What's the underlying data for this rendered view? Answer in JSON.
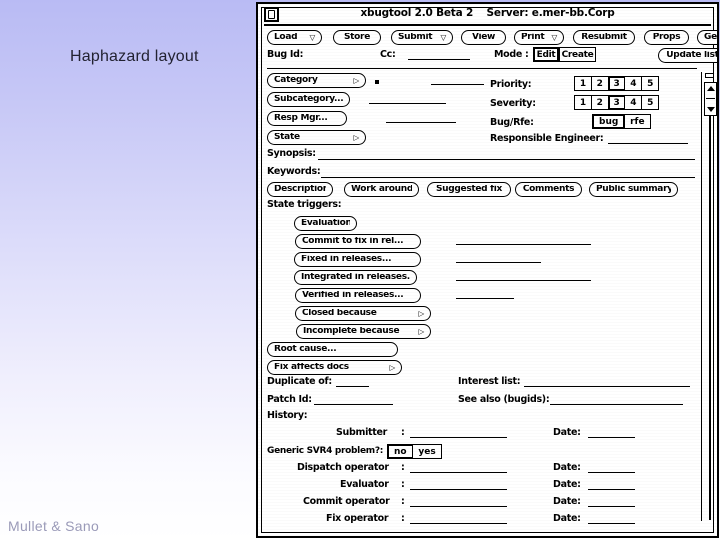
{
  "slide": {
    "title": "Haphazard layout",
    "credit": "Mullet & Sano",
    "background_top": "#b9bbf4",
    "background_bottom": "#ffffff"
  },
  "window": {
    "app_title": "xbugtool 2.0 Beta 2",
    "server_label": "Server: e.mer-bb.Corp",
    "menu_icon": "window-menu-icon",
    "toolbar": [
      {
        "label": "Load",
        "marker": "▽"
      },
      {
        "label": "Store",
        "marker": ""
      },
      {
        "label": "Submit",
        "marker": "▽"
      },
      {
        "label": "View",
        "marker": ""
      },
      {
        "label": "Print",
        "marker": "▽"
      },
      {
        "label": "Resubmit",
        "marker": ""
      },
      {
        "label": "Props",
        "marker": ""
      },
      {
        "label": "Gen. Help",
        "marker": "▽"
      }
    ],
    "update_lists_label": "Update lists",
    "bug_id_label": "Bug Id:",
    "cc_label": "Cc:",
    "mode_label": "Mode :",
    "mode_options": [
      {
        "label": "Edit",
        "selected": true
      },
      {
        "label": "Create",
        "selected": false
      }
    ],
    "left_menu_buttons": [
      {
        "label": "Category",
        "marker": "▷"
      },
      {
        "label": "Subcategory...",
        "marker": ""
      },
      {
        "label": "Resp Mgr...",
        "marker": ""
      },
      {
        "label": "State",
        "marker": "▷"
      }
    ],
    "priority_label": "Priority:",
    "priority_options": [
      "1",
      "2",
      "3",
      "4",
      "5"
    ],
    "priority_selected": "3",
    "severity_label": "Severity:",
    "severity_options": [
      "1",
      "2",
      "3",
      "4",
      "5"
    ],
    "severity_selected": "3",
    "bugrfe_label": "Bug/Rfe:",
    "bugrfe_options": [
      {
        "label": "bug",
        "selected": true
      },
      {
        "label": "rfe",
        "selected": false
      }
    ],
    "responsible_engineer_label": "Responsible Engineer:",
    "synopsis_label": "Synopsis:",
    "keywords_label": "Keywords:",
    "text_section_buttons": [
      "Description",
      "Work around",
      "Suggested fix",
      "Comments",
      "Public summary"
    ],
    "state_triggers_label": "State triggers:",
    "state_triggers": [
      {
        "label": "Evaluation",
        "marker": ""
      },
      {
        "label": "Commit to fix in rel...",
        "marker": ""
      },
      {
        "label": "Fixed in releases...",
        "marker": ""
      },
      {
        "label": "Integrated in releases...",
        "marker": ""
      },
      {
        "label": "Verified in releases...",
        "marker": ""
      },
      {
        "label": "Closed because",
        "marker": "▷"
      },
      {
        "label": "Incomplete because",
        "marker": "▷"
      }
    ],
    "root_cause_label": "Root cause...",
    "fix_affects_docs": {
      "label": "Fix affects docs",
      "marker": "▷"
    },
    "duplicate_of_label": "Duplicate of:",
    "patch_id_label": "Patch Id:",
    "interest_list_label": "Interest list:",
    "see_also_label": "See also (bugids):",
    "history_label": "History:",
    "history_rows": [
      {
        "role": "Submitter",
        "date_label": "Date:"
      },
      {
        "role": "Dispatch operator",
        "date_label": "Date:"
      },
      {
        "role": "Evaluator",
        "date_label": "Date:"
      },
      {
        "role": "Commit operator",
        "date_label": "Date:"
      },
      {
        "role": "Fix operator",
        "date_label": "Date:"
      }
    ],
    "svr4_label": "Generic SVR4 problem?:",
    "svr4_options": [
      {
        "label": "no",
        "selected": true
      },
      {
        "label": "yes",
        "selected": false
      }
    ],
    "field_colon": ":"
  }
}
